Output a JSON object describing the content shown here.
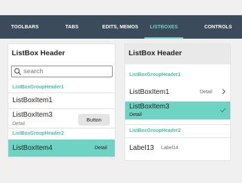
{
  "tabs": [
    {
      "label": "TOOLBARS"
    },
    {
      "label": "TABS"
    },
    {
      "label": "EDITS, MEMOS"
    },
    {
      "label": "LISTBOXES"
    },
    {
      "label": "CONTROLS"
    }
  ],
  "active_tab": "LISTBOXES",
  "accent_color": "#6fd3c3",
  "topbar_color": "#3b4b5c",
  "left_list": {
    "header": "ListBox Header",
    "search_placeholder": "search",
    "group1": "ListBoxGroupHeader1",
    "item1": "ListBoxItem1",
    "item3_title": "ListBoxItem3",
    "item3_detail": "Detail",
    "item3_button": "Button",
    "group2": "ListBoxGroupHeader2",
    "item4_title": "ListBoxItem4",
    "item4_detail": "Detail"
  },
  "right_list": {
    "header": "ListBox Header",
    "group1": "ListBoxGroupHeader1",
    "item1_title": "ListBoxItem1",
    "item1_detail": "Detail",
    "item3_title": "ListBoxItem3",
    "item3_detail": "Detail",
    "group2": "ListBoxGroupHeader2",
    "label13": "Label13",
    "label14": "Label14"
  },
  "icons": [
    "search-icon",
    "chevron-right-icon",
    "checkmark-icon"
  ]
}
